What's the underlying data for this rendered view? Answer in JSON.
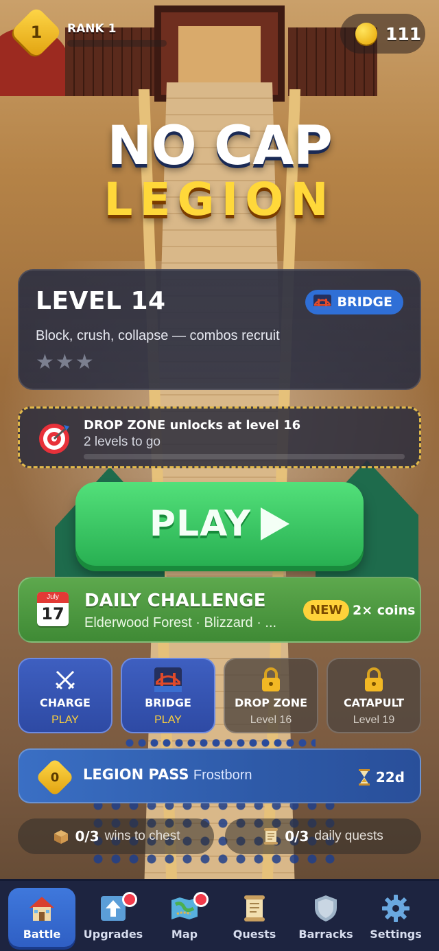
{
  "header": {
    "rank_number": "1",
    "rank_label": "RANK 1",
    "coins": "111"
  },
  "title": {
    "line1": "NO CAP",
    "line2": "LEGION"
  },
  "level": {
    "title": "LEVEL 14",
    "tag": "BRIDGE",
    "description": "Block, crush, collapse — combos recruit",
    "stars": "★★★",
    "stars_earned": 0
  },
  "unlock": {
    "title": "DROP ZONE unlocks at level 16",
    "subtitle": "2 levels to go",
    "progress": 0
  },
  "play": {
    "label": "PLAY"
  },
  "daily": {
    "month": "July",
    "day": "17",
    "title": "DAILY CHALLENGE",
    "subtitle": "Elderwood Forest · Blizzard · ...",
    "badge": "NEW",
    "reward": "2× coins"
  },
  "modes": [
    {
      "name": "CHARGE",
      "status": "PLAY",
      "icon": "swords-icon"
    },
    {
      "name": "BRIDGE",
      "status": "PLAY",
      "icon": "bridge-icon"
    },
    {
      "name": "DROP ZONE",
      "status": "Level 16",
      "icon": "lock-icon"
    },
    {
      "name": "CATAPULT",
      "status": "Level 19",
      "icon": "lock-icon"
    }
  ],
  "pass": {
    "level": "0",
    "title": "LEGION PASS",
    "season": "Frostborn",
    "time_left": "22d"
  },
  "progress": {
    "chest_count": "0/3",
    "chest_label": "wins to chest",
    "quests_count": "0/3",
    "quests_label": "daily quests"
  },
  "nav": [
    {
      "label": "Battle",
      "icon": "house-icon",
      "active": true
    },
    {
      "label": "Upgrades",
      "icon": "upgrade-arrow-icon",
      "badge": true
    },
    {
      "label": "Map",
      "icon": "map-icon",
      "badge": true
    },
    {
      "label": "Quests",
      "icon": "scroll-icon"
    },
    {
      "label": "Barracks",
      "icon": "shield-icon"
    },
    {
      "label": "Settings",
      "icon": "gear-icon"
    }
  ],
  "colors": {
    "play": "#33c25e",
    "accent": "#2f6fd6",
    "gold": "#ffd23a",
    "badge": "#f23a4a"
  }
}
